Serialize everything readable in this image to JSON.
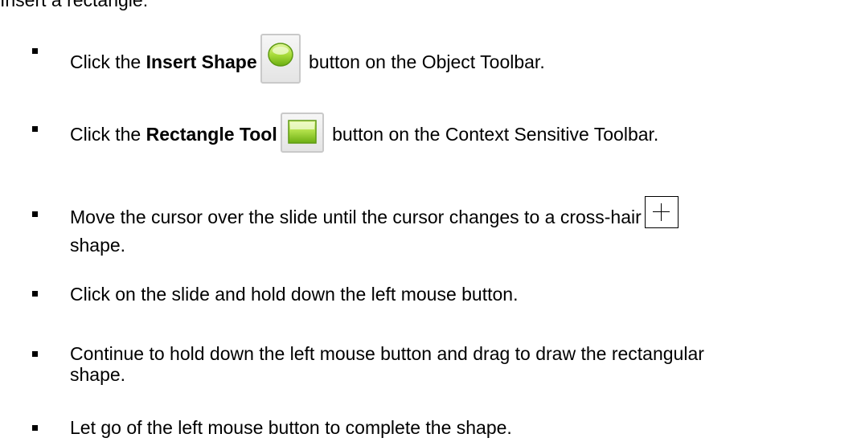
{
  "intro": "Insert a rectangle:",
  "steps": [
    {
      "pre": "Click the ",
      "bold": "Insert Shape",
      "post": " button on the Object Toolbar.",
      "icon": "insert-shape-icon"
    },
    {
      "pre": "Click the ",
      "bold": "Rectangle Tool",
      "post": " button on the Context Sensitive Toolbar.",
      "icon": "rectangle-tool-icon"
    },
    {
      "line1": "Move the cursor over the slide until the cursor changes to a cross-hair",
      "line2": "shape.",
      "icon": "crosshair-cursor-icon"
    },
    {
      "text": "Click on the slide and hold down the left mouse button."
    },
    {
      "line1": "Continue to hold down the left mouse button and drag to draw the rectangular",
      "line2": "shape."
    },
    {
      "text": "Let go of the left mouse button to complete the shape."
    }
  ],
  "colors": {
    "icon_green_light": "#d6f27a",
    "icon_green_dark": "#7cc21a",
    "icon_border": "#5e9a12"
  }
}
